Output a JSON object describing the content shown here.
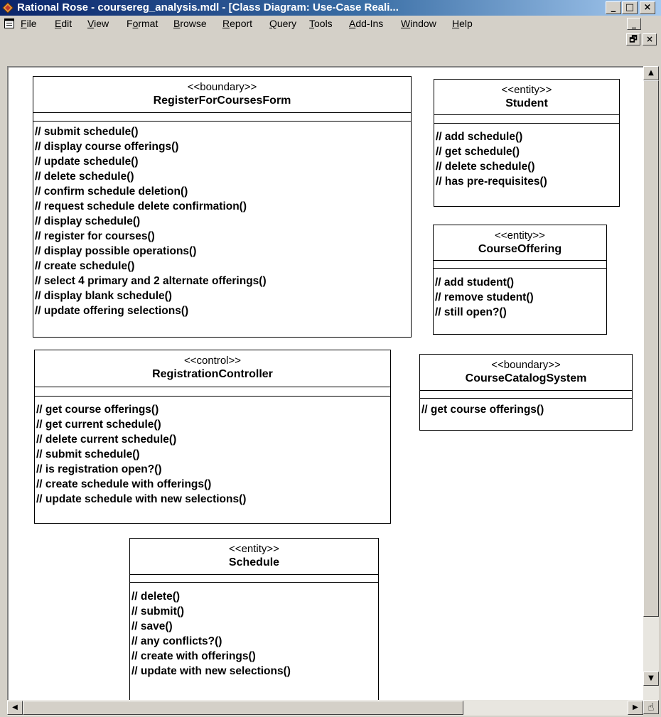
{
  "window": {
    "title": "Rational Rose - coursereg_analysis.mdl - [Class Diagram: Use-Case Reali...",
    "controls": {
      "minimize": "_",
      "maximize": "□",
      "close": "×"
    }
  },
  "menu": {
    "items": [
      "File",
      "Edit",
      "View",
      "Format",
      "Browse",
      "Report",
      "Query",
      "Tools",
      "Add-Ins",
      "Window",
      "Help"
    ],
    "underline": [
      "F",
      "E",
      "V",
      "o",
      "B",
      "R",
      "Q",
      "T",
      "A",
      "W",
      "H"
    ],
    "mdi": {
      "minimize": "_",
      "restore": "🗗",
      "close": "×"
    }
  },
  "diagram": {
    "classes": [
      {
        "stereotype": "<<boundary>>",
        "name": "RegisterForCoursesForm",
        "operations": [
          "// submit schedule()",
          "// display course offerings()",
          "// update schedule()",
          "// delete schedule()",
          "// confirm schedule deletion()",
          "// request schedule delete confirmation()",
          "// display schedule()",
          "// register for courses()",
          "// display possible operations()",
          "// create schedule()",
          "// select 4 primary and 2 alternate offerings()",
          "// display blank schedule()",
          "// update offering selections()"
        ]
      },
      {
        "stereotype": "<<entity>>",
        "name": "Student",
        "operations": [
          "// add schedule()",
          "// get schedule()",
          "// delete schedule()",
          "// has pre-requisites()"
        ]
      },
      {
        "stereotype": "<<entity>>",
        "name": "CourseOffering",
        "operations": [
          "// add student()",
          "// remove student()",
          "// still open?()"
        ]
      },
      {
        "stereotype": "<<control>>",
        "name": "RegistrationController",
        "operations": [
          "// get course offerings()",
          "// get current schedule()",
          "// delete current schedule()",
          "// submit schedule()",
          "// is registration open?()",
          "// create schedule with offerings()",
          "// update schedule with new selections()"
        ]
      },
      {
        "stereotype": "<<boundary>>",
        "name": "CourseCatalogSystem",
        "operations": [
          "// get course offerings()"
        ]
      },
      {
        "stereotype": "<<entity>>",
        "name": "Schedule",
        "operations": [
          "// delete()",
          "// submit()",
          "// save()",
          "// any conflicts?()",
          "// create with offerings()",
          "// update with new selections()"
        ]
      }
    ]
  },
  "scrollbars": {
    "up_arrow": "▲",
    "down_arrow": "▼",
    "left_arrow": "◀",
    "right_arrow": "▶",
    "hand_tool": "☝"
  }
}
